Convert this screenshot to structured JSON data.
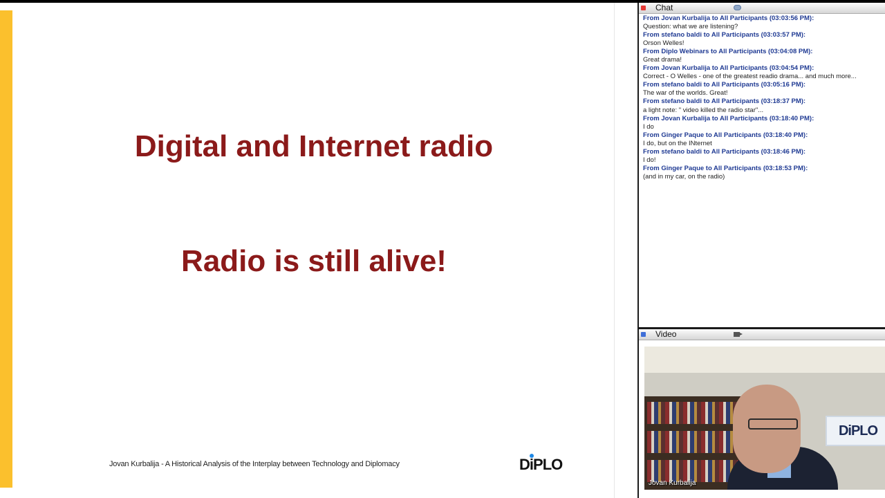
{
  "slide": {
    "title": "Digital and Internet radio",
    "subtitle": "Radio is still alive!",
    "footer": "Jovan Kurbalija - A Historical Analysis of the Interplay between Technology and Diplomacy",
    "logo_text_pre": "D",
    "logo_text_i": "i",
    "logo_text_post": "PLO"
  },
  "chat": {
    "title": "Chat",
    "messages": [
      {
        "header": "From Jovan Kurbalija to All Participants (03:03:56 PM):",
        "body": "Question: what we are listening?"
      },
      {
        "header": "From stefano baldi to All Participants (03:03:57 PM):",
        "body": "Orson Welles!"
      },
      {
        "header": "From Diplo Webinars to All Participants (03:04:08 PM):",
        "body": "Great drama!"
      },
      {
        "header": "From Jovan Kurbalija to All Participants (03:04:54 PM):",
        "body": "Correct - O Welles - one of the greatest readio drama... and much more..."
      },
      {
        "header": "From stefano baldi to All Participants (03:05:16 PM):",
        "body": "The war of the worlds. Great!"
      },
      {
        "header": "From stefano baldi to All Participants (03:18:37 PM):",
        "body": "a light note: \" video killed the radio star\"..."
      },
      {
        "header": "From Jovan Kurbalija to All Participants (03:18:40 PM):",
        "body": "I do"
      },
      {
        "header": "From Ginger Paque to All Participants (03:18:40 PM):",
        "body": "I do, but on the INternet"
      },
      {
        "header": "From stefano baldi to All Participants (03:18:46 PM):",
        "body": "I do!"
      },
      {
        "header": "From Ginger Paque to All Participants (03:18:53 PM):",
        "body": "(and in my car, on the radio)"
      }
    ]
  },
  "video": {
    "title": "Video",
    "speaker_name": "Jovan Kurbalija",
    "banner_text": "DiPLO"
  },
  "colors": {
    "slide_text": "#8b1a1a",
    "accent_bar": "#fbc02d",
    "chat_header_text": "#1f3a93"
  }
}
